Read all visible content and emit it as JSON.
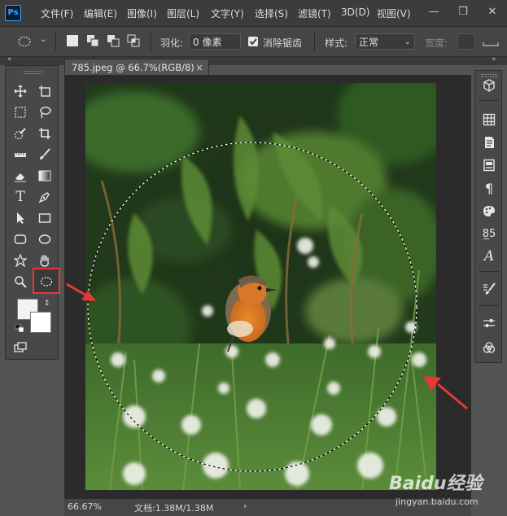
{
  "app": {
    "logo_text": "Ps"
  },
  "menubar": {
    "items": [
      "文件(F)",
      "编辑(E)",
      "图像(I)",
      "图层(L)",
      "文字(Y)",
      "选择(S)",
      "滤镜(T)",
      "3D(D)",
      "视图(V)"
    ]
  },
  "window_controls": {
    "minimize": "—",
    "restore": "❐",
    "close": "✕"
  },
  "options": {
    "feather_label": "羽化:",
    "feather_value": "0 像素",
    "antialias_label": "消除锯齿",
    "antialias_checked": true,
    "style_label": "样式:",
    "style_value": "正常",
    "width_label": "宽度:"
  },
  "document": {
    "tab_title": "785.jpeg @ 66.7%(RGB/8)",
    "close_glyph": "×"
  },
  "status": {
    "zoom": "66.67%",
    "doc_info": "文档:1.38M/1.38M",
    "arrow": "›"
  },
  "watermark": {
    "text": "Baidu经验",
    "url": "jingyan.baidu.com"
  },
  "annotations": {
    "highlight_color": "#e53935",
    "arrow_color": "#e53935"
  },
  "icons": {
    "toolbar": [
      "move-icon",
      "artboard-icon",
      "marquee-rect-icon",
      "lasso-icon",
      "quick-select-icon",
      "crop-icon",
      "ruler-icon",
      "brush-icon",
      "eraser-icon",
      "gradient-icon",
      "type-icon",
      "pen-icon",
      "path-select-icon",
      "rectangle-icon",
      "rounded-rect-icon",
      "ellipse-icon",
      "custom-shape-icon",
      "hand-icon",
      "zoom-icon",
      "elliptical-marquee-icon",
      "foreground-color-icon",
      "background-color-icon",
      "screen-mode-icon"
    ],
    "rightdock": [
      "3d-icon",
      "grid-icon",
      "properties-icon",
      "adjustments-icon",
      "paragraph-icon",
      "swatches-icon",
      "character-styles-icon",
      "glyphs-icon",
      "brushes-icon",
      "layers-icon",
      "channels-icon"
    ]
  }
}
